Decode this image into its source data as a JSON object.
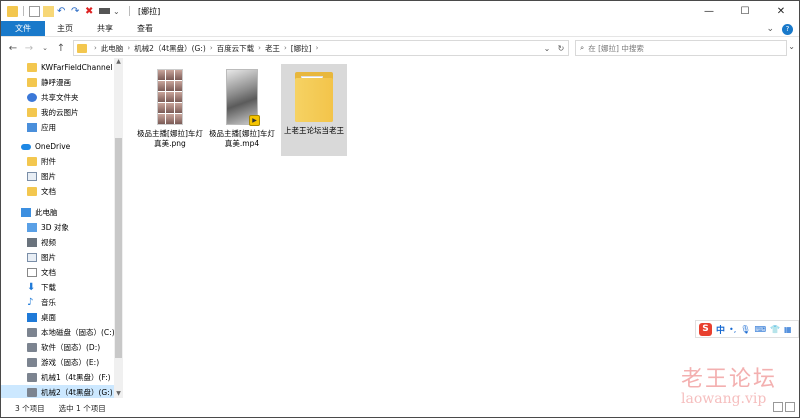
{
  "window": {
    "title": "[娜拉]",
    "controls": {
      "minimize": "—",
      "maximize": "☐",
      "close": "✕"
    }
  },
  "ribbon": {
    "tabs": [
      "文件",
      "主页",
      "共享",
      "查看"
    ],
    "expand_icon": "chevron-down-icon",
    "help_label": "?"
  },
  "address": {
    "crumbs": [
      "此电脑",
      "机械2（4t黑盘）(G:)",
      "百度云下载",
      "老王",
      "[娜拉]"
    ],
    "search_placeholder": "在 [娜拉] 中搜索"
  },
  "nav": {
    "items": [
      {
        "label": "KWFarFieldChannel",
        "icon": "folder-icon"
      },
      {
        "label": "静呼漫画",
        "icon": "folder-icon"
      },
      {
        "label": "共享文件夹",
        "icon": "shared-folder-icon"
      },
      {
        "label": "我的云图片",
        "icon": "folder-icon"
      },
      {
        "label": "应用",
        "icon": "apps-icon"
      },
      {
        "label": "OneDrive",
        "icon": "cloud-icon"
      },
      {
        "label": "附件",
        "icon": "folder-icon"
      },
      {
        "label": "图片",
        "icon": "pictures-icon"
      },
      {
        "label": "文档",
        "icon": "folder-icon"
      },
      {
        "label": "此电脑",
        "icon": "computer-icon"
      },
      {
        "label": "3D 对象",
        "icon": "3d-objects-icon"
      },
      {
        "label": "视频",
        "icon": "videos-icon"
      },
      {
        "label": "图片",
        "icon": "pictures-icon"
      },
      {
        "label": "文档",
        "icon": "documents-icon"
      },
      {
        "label": "下载",
        "icon": "download-icon"
      },
      {
        "label": "音乐",
        "icon": "music-icon"
      },
      {
        "label": "桌面",
        "icon": "desktop-icon"
      },
      {
        "label": "本地磁盘（固态）(C:)",
        "icon": "drive-icon"
      },
      {
        "label": "软件（固态）(D:)",
        "icon": "drive-icon"
      },
      {
        "label": "游戏（固态）(E:)",
        "icon": "drive-icon"
      },
      {
        "label": "机械1（4t黑盘）(F:)",
        "icon": "drive-icon"
      },
      {
        "label": "机械2（4t黑盘）(G:)",
        "icon": "drive-icon"
      }
    ]
  },
  "files": [
    {
      "name": "极品主播[娜拉]车灯真美.png",
      "type": "image"
    },
    {
      "name": "极品主播[娜拉]车灯真美.mp4",
      "type": "video"
    },
    {
      "name": "上老王论坛当老王",
      "type": "folder"
    }
  ],
  "status": {
    "item_count": "3 个项目",
    "selection": "选中 1 个项目"
  },
  "ime": {
    "logo": "S",
    "mode": "中",
    "punct": "•,",
    "mic": "🎙",
    "keyboard": "⌨",
    "skin": "👕",
    "grid": "▦"
  },
  "watermark": {
    "title": "老王论坛",
    "domain": "laowang.vip"
  },
  "colors": {
    "accent": "#1979ca",
    "selection": "#cce8ff",
    "folder": "#f3c74f"
  }
}
